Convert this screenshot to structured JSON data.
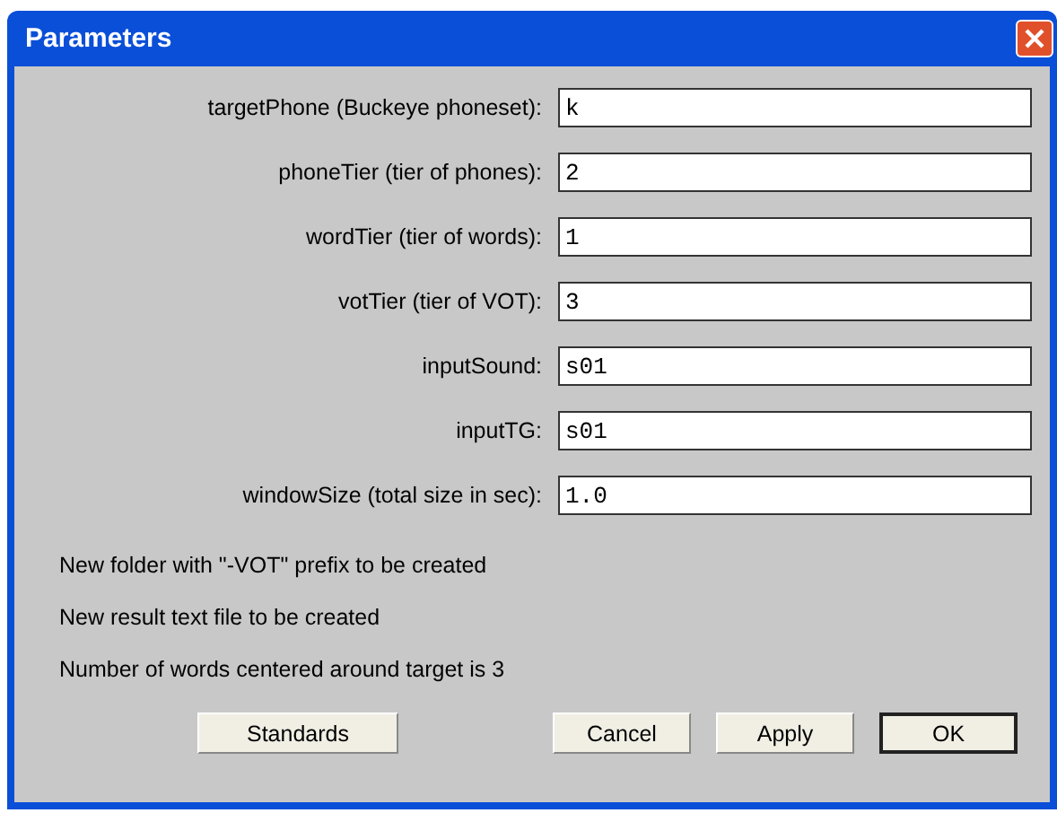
{
  "window": {
    "title": "Parameters"
  },
  "fields": [
    {
      "label": "targetPhone (Buckeye phoneset):",
      "value": "k"
    },
    {
      "label": "phoneTier (tier of phones):",
      "value": "2"
    },
    {
      "label": "wordTier (tier of words):",
      "value": "1"
    },
    {
      "label": "votTier (tier of VOT):",
      "value": "3"
    },
    {
      "label": "inputSound:",
      "value": "s01"
    },
    {
      "label": "inputTG:",
      "value": "s01"
    },
    {
      "label": "windowSize (total size in sec):",
      "value": "1.0"
    }
  ],
  "notes": [
    "New folder with \"-VOT\" prefix to be created",
    "New result text file to be created",
    "Number of words centered around target is 3"
  ],
  "buttons": [
    {
      "label": "Standards",
      "default": false
    },
    {
      "label": "Cancel",
      "default": false
    },
    {
      "label": "Apply",
      "default": false
    },
    {
      "label": "OK",
      "default": true
    }
  ]
}
